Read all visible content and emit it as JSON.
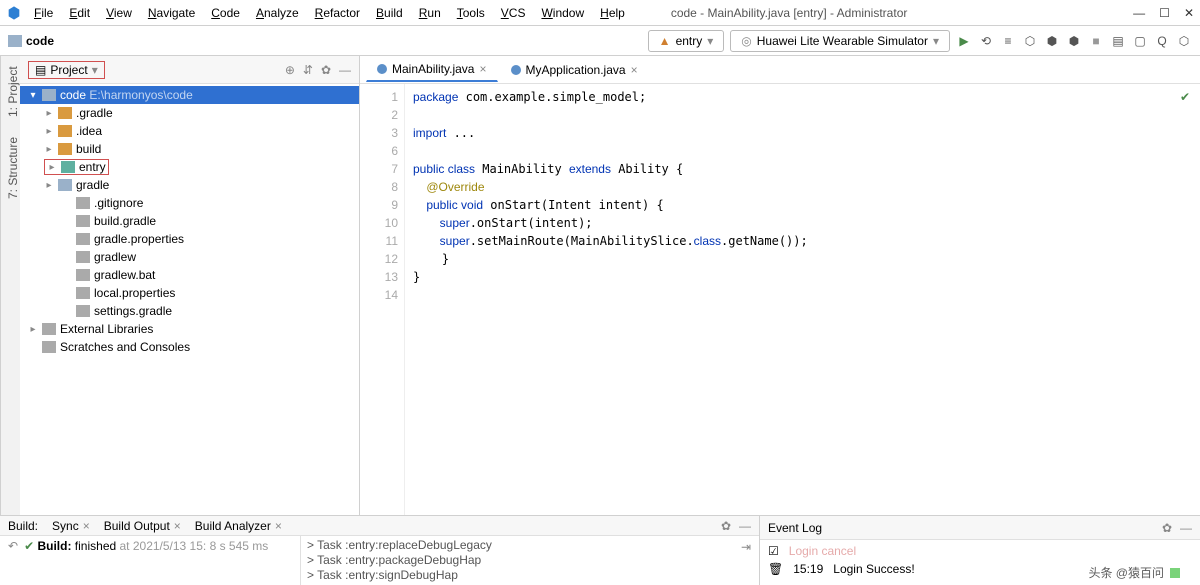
{
  "title": "code - MainAbility.java [entry] - Administrator",
  "menu": [
    "File",
    "Edit",
    "View",
    "Navigate",
    "Code",
    "Analyze",
    "Refactor",
    "Build",
    "Run",
    "Tools",
    "VCS",
    "Window",
    "Help"
  ],
  "breadcrumb": "code",
  "run_config": "entry",
  "device": "Huawei Lite Wearable Simulator",
  "panel": {
    "title": "Project"
  },
  "tree": [
    {
      "label": "code",
      "path": "E:\\harmonyos\\code",
      "cls": "selected",
      "ind": 0,
      "arrow": "▾",
      "icon": "folder-gray"
    },
    {
      "label": ".gradle",
      "cls": "",
      "ind": 1,
      "arrow": "▸",
      "icon": "folder-orange"
    },
    {
      "label": ".idea",
      "cls": "",
      "ind": 1,
      "arrow": "▸",
      "icon": "folder-orange"
    },
    {
      "label": "build",
      "cls": "",
      "ind": 1,
      "arrow": "▸",
      "icon": "folder-orange"
    },
    {
      "label": "entry",
      "cls": "red-box",
      "ind": 1,
      "arrow": "▸",
      "icon": "folder-teal"
    },
    {
      "label": "gradle",
      "cls": "",
      "ind": 1,
      "arrow": "▸",
      "icon": "folder-gray"
    },
    {
      "label": ".gitignore",
      "cls": "",
      "ind": 2,
      "arrow": "",
      "icon": "file-gray"
    },
    {
      "label": "build.gradle",
      "cls": "",
      "ind": 2,
      "arrow": "",
      "icon": "file-gray"
    },
    {
      "label": "gradle.properties",
      "cls": "",
      "ind": 2,
      "arrow": "",
      "icon": "file-gray"
    },
    {
      "label": "gradlew",
      "cls": "",
      "ind": 2,
      "arrow": "",
      "icon": "file-gray"
    },
    {
      "label": "gradlew.bat",
      "cls": "",
      "ind": 2,
      "arrow": "",
      "icon": "file-gray"
    },
    {
      "label": "local.properties",
      "cls": "",
      "ind": 2,
      "arrow": "",
      "icon": "file-gray"
    },
    {
      "label": "settings.gradle",
      "cls": "",
      "ind": 2,
      "arrow": "",
      "icon": "file-gray"
    },
    {
      "label": "External Libraries",
      "cls": "",
      "ind": 0,
      "arrow": "▸",
      "icon": "file-gray"
    },
    {
      "label": "Scratches and Consoles",
      "cls": "",
      "ind": 0,
      "arrow": "",
      "icon": "file-gray"
    }
  ],
  "tabs": [
    {
      "label": "MainAbility.java",
      "active": true
    },
    {
      "label": "MyApplication.java",
      "active": false
    }
  ],
  "line_numbers": [
    1,
    2,
    3,
    6,
    7,
    8,
    9,
    10,
    11,
    12,
    13,
    14
  ],
  "code": {
    "l1a": "package",
    "l1b": " com.example.simple_model;",
    "l3a": "import",
    "l3b": " ...",
    "l7a": "public class",
    "l7b": " MainAbility ",
    "l7c": "extends",
    "l7d": " Ability {",
    "l8": "    @Override",
    "l9a": "    public void",
    "l9b": " onStart(Intent intent) {",
    "l10a": "        super",
    "l10b": ".onStart(intent);",
    "l11a": "        super",
    "l11b": ".setMainRoute(MainAbilitySlice.",
    "l11c": "class",
    "l11d": ".getName());",
    "l12": "    }",
    "l13": "}"
  },
  "build": {
    "label": "Build:",
    "tabs": [
      "Sync",
      "Build Output",
      "Build Analyzer"
    ],
    "status_a": "Build:",
    "status_b": " finished ",
    "status_c": "at 2021/5/13 15: 8 s 545 ms",
    "tasks": [
      "> Task :entry:replaceDebugLegacy",
      "> Task :entry:packageDebugHap",
      "> Task :entry:signDebugHap"
    ]
  },
  "event": {
    "title": "Event Log",
    "rows": [
      {
        "time": "",
        "msg": "Login cancel",
        "color": "#cc5555"
      },
      {
        "time": "15:19",
        "msg": "Login Success!",
        "color": "#333"
      }
    ]
  },
  "side_tabs": [
    "1: Project",
    "7: Structure"
  ],
  "watermark": "头条  @猿百问"
}
